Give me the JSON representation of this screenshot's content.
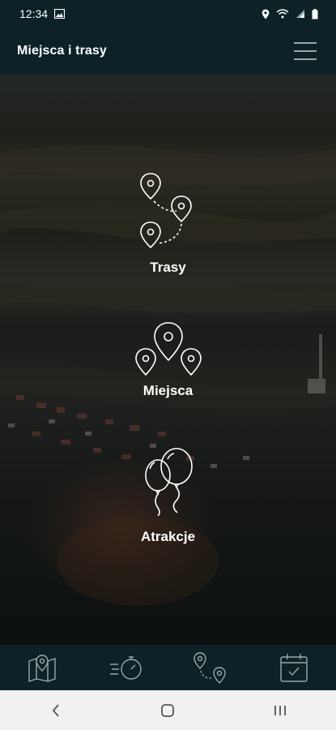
{
  "status_bar": {
    "time": "12:34",
    "icons": [
      "image-icon",
      "location-icon",
      "wifi-icon",
      "signal-icon",
      "battery-icon"
    ]
  },
  "app_bar": {
    "title": "Miejsca i trasy",
    "menu_icon": "hamburger-menu-icon"
  },
  "tiles": [
    {
      "label": "Trasy",
      "icon": "route-pins-icon"
    },
    {
      "label": "Miejsca",
      "icon": "places-pins-icon"
    },
    {
      "label": "Atrakcje",
      "icon": "balloons-icon"
    }
  ],
  "bottom_nav": {
    "items": [
      {
        "icon": "map-pin-icon"
      },
      {
        "icon": "stopwatch-icon"
      },
      {
        "icon": "route-icon"
      },
      {
        "icon": "calendar-check-icon"
      }
    ]
  },
  "system_nav": {
    "items": [
      {
        "icon": "back-icon"
      },
      {
        "icon": "home-icon"
      },
      {
        "icon": "recents-icon"
      }
    ]
  },
  "colors": {
    "bar_background": "#0c2226",
    "icon_stroke": "#ffffff",
    "nav_icon_stroke": "#9aa8aa",
    "system_bar": "#f1f1f1"
  }
}
